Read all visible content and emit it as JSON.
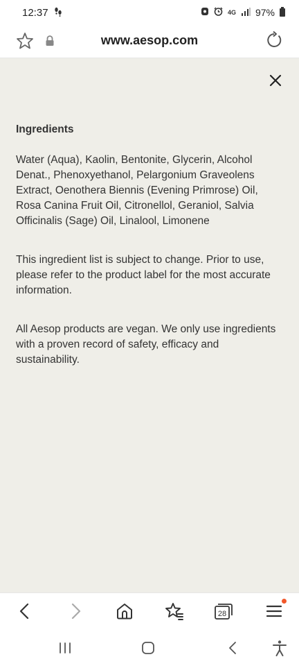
{
  "status_bar": {
    "time": "12:37",
    "battery": "97%",
    "network": "4G"
  },
  "browser": {
    "url": "www.aesop.com"
  },
  "modal": {
    "heading": "Ingredients",
    "ingredients": "Water (Aqua), Kaolin, Bentonite, Glycerin, Alcohol Denat., Phenoxyethanol, Pelargonium Graveolens Extract, Oenothera Biennis (Evening Primrose) Oil, Rosa Canina Fruit Oil, Citronellol, Geraniol, Salvia Officinalis (Sage) Oil, Linalool, Limonene",
    "notice": "This ingredient list is subject to change. Prior to use, please refer to the product label for the most accurate information.",
    "vegan": "All Aesop products are vegan. We only use ingredients with a proven record of safety, efficacy and sustainability."
  },
  "toolbar": {
    "tab_count": "28"
  },
  "colors": {
    "content_background": "#efeee8",
    "notification_dot": "#f2582b"
  },
  "icons": [
    "bookmark-star-icon",
    "lock-icon",
    "reload-icon",
    "close-icon",
    "back-arrow-icon",
    "forward-arrow-icon",
    "home-icon",
    "bookmarks-icon",
    "tabs-icon",
    "menu-icon",
    "recents-icon",
    "nav-home-icon",
    "nav-back-icon",
    "accessibility-icon"
  ]
}
